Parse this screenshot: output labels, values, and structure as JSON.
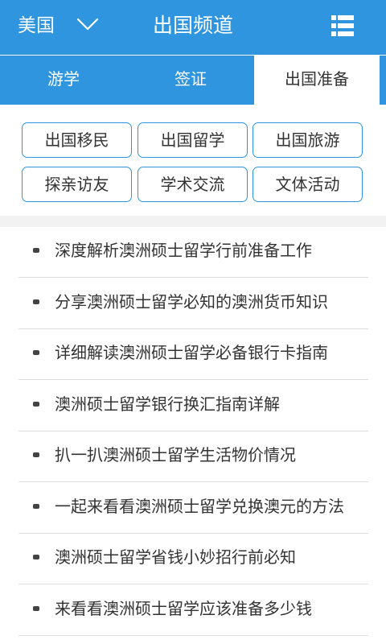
{
  "header": {
    "country": "美国",
    "title": "出国频道"
  },
  "tabs": [
    {
      "label": "游学",
      "active": false
    },
    {
      "label": "签证",
      "active": false
    },
    {
      "label": "出国准备",
      "active": true
    }
  ],
  "categories": [
    {
      "label": "出国移民"
    },
    {
      "label": "出国留学"
    },
    {
      "label": "出国旅游"
    },
    {
      "label": "探亲访友"
    },
    {
      "label": "学术交流"
    },
    {
      "label": "文体活动"
    }
  ],
  "articles": [
    {
      "title": "深度解析澳洲硕士留学行前准备工作"
    },
    {
      "title": "分享澳洲硕士留学必知的澳洲货币知识"
    },
    {
      "title": "详细解读澳洲硕士留学必备银行卡指南"
    },
    {
      "title": "澳洲硕士留学银行换汇指南详解"
    },
    {
      "title": "扒一扒澳洲硕士留学生活物价情况"
    },
    {
      "title": "一起来看看澳洲硕士留学兑换澳元的方法"
    },
    {
      "title": "澳洲硕士留学省钱小妙招行前必知"
    },
    {
      "title": "来看看澳洲硕士留学应该准备多少钱"
    }
  ],
  "colors": {
    "brand": "#2f95de"
  }
}
